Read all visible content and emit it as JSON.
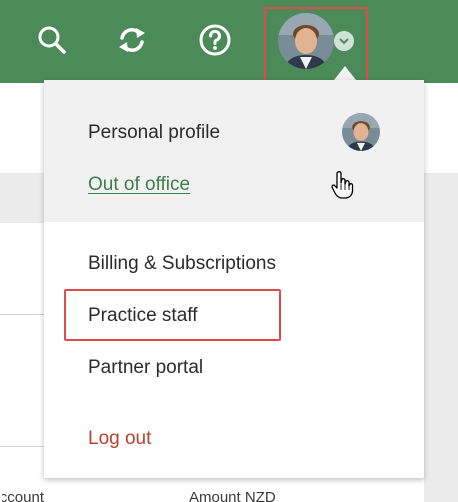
{
  "toolbar": {
    "search_icon": "search-icon",
    "sync_icon": "sync-icon",
    "help_icon": "help-icon",
    "avatar_icon": "avatar",
    "chevron_icon": "chevron-down-icon"
  },
  "menu": {
    "personal_profile": "Personal profile",
    "out_of_office": "Out of office",
    "billing": "Billing & Subscriptions",
    "practice_staff": "Practice staff",
    "partner_portal": "Partner portal",
    "log_out": "Log out"
  },
  "background_table": {
    "col1_header": "Account",
    "col2_header": "Amount NZD"
  },
  "colors": {
    "topbar": "#4c8a59",
    "link_green": "#3e7d4d",
    "logout_red": "#b8412f",
    "highlight": "#e04b4b"
  }
}
